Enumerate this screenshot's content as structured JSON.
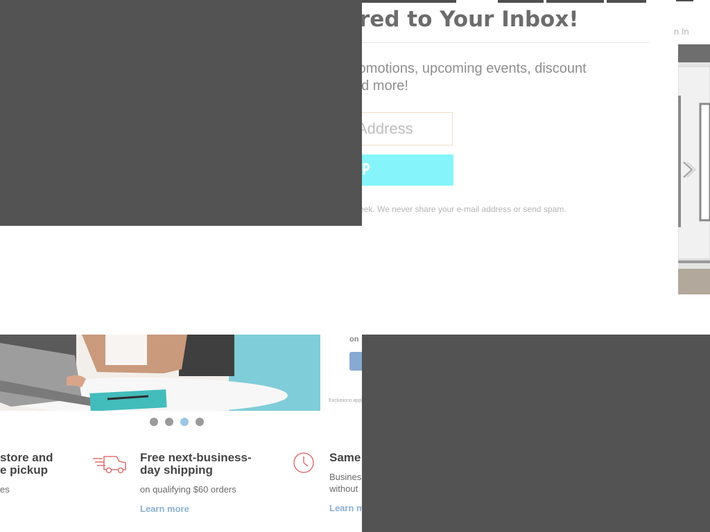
{
  "header": {
    "sign_in_label": "n In"
  },
  "newsletter": {
    "title": "red to Your Inbox!",
    "description": "romotions, upcoming events, discount\nnd more!",
    "email_placeholder": "Address",
    "signup_label": "SIGN UP",
    "fine_print": "eek.   We never share your e-mail address or send spam."
  },
  "hero": {
    "carousel": {
      "count": 4,
      "active_index": 2
    },
    "promo": {
      "on_label": "on",
      "fine_print": "Exclusions apply"
    }
  },
  "features": [
    {
      "title": "store and\ne pickup",
      "subtitle": "es",
      "link_label": "",
      "icon": "store-icon"
    },
    {
      "title": "Free next-business-\nday shipping",
      "subtitle": "on qualifying $60 orders",
      "link_label": "Learn more",
      "icon": "delivery-truck-icon"
    },
    {
      "title": "Same",
      "subtitle": "Busines\nwithout",
      "link_label": "Learn m",
      "icon": "clock-icon"
    }
  ],
  "colors": {
    "overlay": "#535353",
    "signup_button": "#86f5fb",
    "link": "#8bb0d3",
    "active_dot": "#9cc7e3",
    "icon_accent": "#d95c5c"
  }
}
